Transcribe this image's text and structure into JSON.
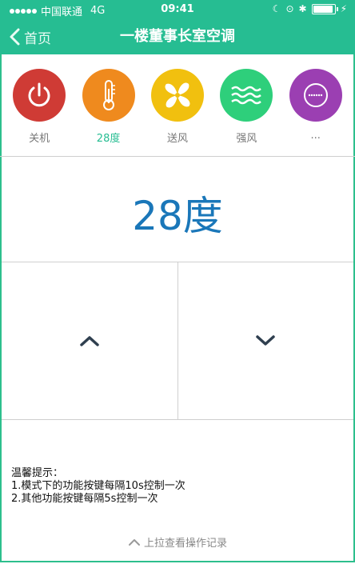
{
  "statusbar": {
    "carrier": "中国联通",
    "network": "4G",
    "time": "09:41"
  },
  "navbar": {
    "back_label": "首页",
    "title": "一楼董事长室空调"
  },
  "modes": [
    {
      "label": "关机",
      "color": "#cf3b35",
      "icon": "power-icon"
    },
    {
      "label": "28度",
      "color": "#ef8a1e",
      "icon": "thermometer-icon",
      "active": true
    },
    {
      "label": "送风",
      "color": "#f1c00f",
      "icon": "fan-icon"
    },
    {
      "label": "强风",
      "color": "#2ecf7b",
      "icon": "wind-icon"
    },
    {
      "label": "...",
      "color": "#9b3fb2",
      "icon": "more-icon"
    }
  ],
  "temperature": {
    "display": "28度"
  },
  "tips": {
    "title": "温馨提示：",
    "line1": "1.模式下的功能按键每隔10s控制一次",
    "line2": "2.其他功能按键每隔5s控制一次"
  },
  "footer": {
    "pull_label": "上拉查看操作记录"
  },
  "colors": {
    "accent": "#26bd92",
    "temp_text": "#1a77b9"
  }
}
